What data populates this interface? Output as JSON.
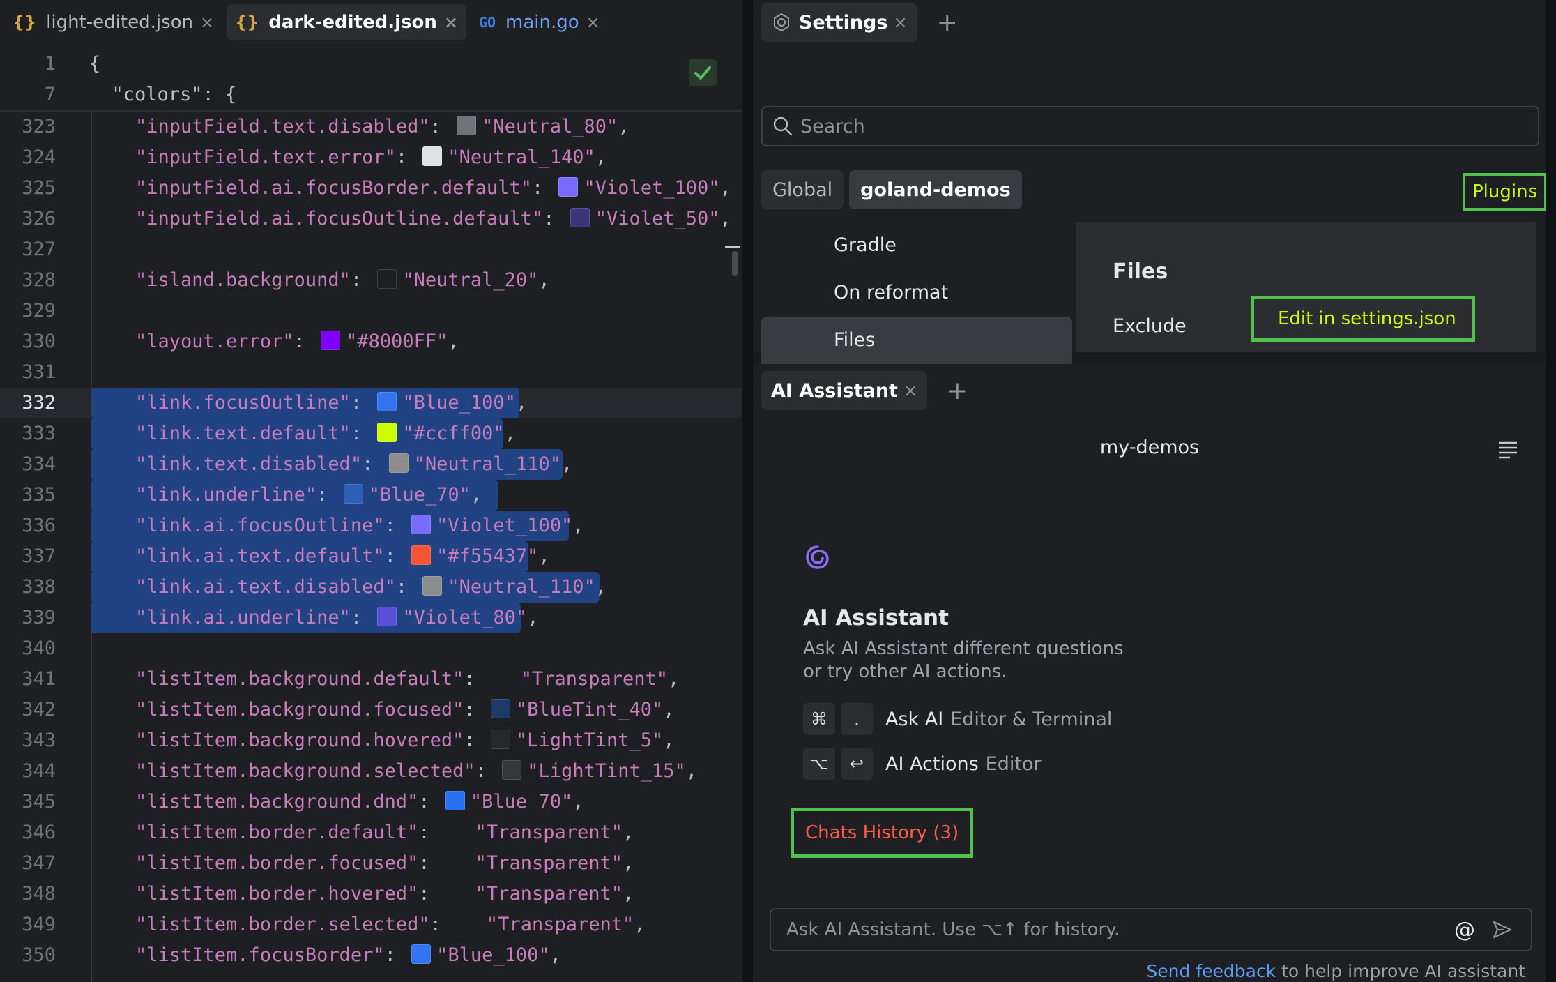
{
  "editor": {
    "tabs": [
      {
        "label": "light-edited.json",
        "icon": "json-braces-icon"
      },
      {
        "label": "dark-edited.json",
        "icon": "json-braces-icon"
      },
      {
        "label": "main.go",
        "icon": "go-file-icon",
        "icon_text": "GO"
      }
    ],
    "icon_json": "{}",
    "sticky": [
      {
        "num": "1",
        "text": "{"
      },
      {
        "num": "7",
        "text": "  \"colors\": {"
      }
    ],
    "lines": [
      {
        "num": "323",
        "key": "\"inputField.text.disabled\"",
        "sep": ": ",
        "color": "#6f737a",
        "val": "\"Neutral_80\"",
        "tail": ","
      },
      {
        "num": "324",
        "key": "\"inputField.text.error\"",
        "sep": ": ",
        "color": "#dfe1e5",
        "val": "\"Neutral_140\"",
        "tail": ","
      },
      {
        "num": "325",
        "key": "\"inputField.ai.focusBorder.default\"",
        "sep": ": ",
        "color": "#7a6bff",
        "val": "\"Violet_100\"",
        "tail": ","
      },
      {
        "num": "326",
        "key": "\"inputField.ai.focusOutline.default\"",
        "sep": ": ",
        "color": "#3d3577",
        "val": "\"Violet_50\"",
        "tail": ","
      },
      {
        "num": "327"
      },
      {
        "num": "328",
        "key": "\"island.background\"",
        "sep": ": ",
        "color": "#1e1f22",
        "val": "\"Neutral_20\"",
        "tail": ","
      },
      {
        "num": "329"
      },
      {
        "num": "330",
        "key": "\"layout.error\"",
        "sep": ": ",
        "color": "#8000ff",
        "val": "\"#8000FF\"",
        "tail": ","
      },
      {
        "num": "331"
      },
      {
        "num": "332",
        "key": "\"link.focusOutline\"",
        "sep": ": ",
        "color": "#3574f0",
        "val": "\"Blue_100\"",
        "tail": ","
      },
      {
        "num": "333",
        "key": "\"link.text.default\"",
        "sep": ": ",
        "color": "#ccff00",
        "val": "\"#ccff00\"",
        "tail": ","
      },
      {
        "num": "334",
        "key": "\"link.text.disabled\"",
        "sep": ": ",
        "color": "#8c8c8c",
        "val": "\"Neutral_110\"",
        "tail": ","
      },
      {
        "num": "335",
        "key": "\"link.underline\"",
        "sep": ": ",
        "color": "#2e5fb8",
        "val": "\"Blue_70\"",
        "tail": ","
      },
      {
        "num": "336",
        "key": "\"link.ai.focusOutline\"",
        "sep": ": ",
        "color": "#7a6bff",
        "val": "\"Violet_100\"",
        "tail": ","
      },
      {
        "num": "337",
        "key": "\"link.ai.text.default\"",
        "sep": ": ",
        "color": "#f55437",
        "val": "\"#f55437\"",
        "tail": ","
      },
      {
        "num": "338",
        "key": "\"link.ai.text.disabled\"",
        "sep": ": ",
        "color": "#8c8c8c",
        "val": "\"Neutral_110\"",
        "tail": ","
      },
      {
        "num": "339",
        "key": "\"link.ai.underline\"",
        "sep": ": ",
        "color": "#5a4fd6",
        "val": "\"Violet_80\"",
        "tail": ","
      },
      {
        "num": "340"
      },
      {
        "num": "341",
        "key": "\"listItem.background.default\"",
        "sep": ":    ",
        "val": "\"Transparent\"",
        "tail": ","
      },
      {
        "num": "342",
        "key": "\"listItem.background.focused\"",
        "sep": ": ",
        "color": "#1d3b66",
        "val": "\"BlueTint_40\"",
        "tail": ","
      },
      {
        "num": "343",
        "key": "\"listItem.background.hovered\"",
        "sep": ": ",
        "color": "#26282b",
        "val": "\"LightTint_5\"",
        "tail": ","
      },
      {
        "num": "344",
        "key": "\"listItem.background.selected\"",
        "sep": ": ",
        "color": "#34363a",
        "val": "\"LightTint_15\"",
        "tail": ","
      },
      {
        "num": "345",
        "key": "\"listItem.background.dnd\"",
        "sep": ": ",
        "color": "#2672f0",
        "val": "\"Blue 70\"",
        "tail": ","
      },
      {
        "num": "346",
        "key": "\"listItem.border.default\"",
        "sep": ":    ",
        "val": "\"Transparent\"",
        "tail": ","
      },
      {
        "num": "347",
        "key": "\"listItem.border.focused\"",
        "sep": ":    ",
        "val": "\"Transparent\"",
        "tail": ","
      },
      {
        "num": "348",
        "key": "\"listItem.border.hovered\"",
        "sep": ":    ",
        "val": "\"Transparent\"",
        "tail": ","
      },
      {
        "num": "349",
        "key": "\"listItem.border.selected\"",
        "sep": ":    ",
        "val": "\"Transparent\"",
        "tail": ","
      },
      {
        "num": "350",
        "key": "\"listItem.focusBorder\"",
        "sep": ": ",
        "color": "#3574f0",
        "val": "\"Blue_100\"",
        "tail": ","
      }
    ],
    "current_line": "332",
    "selected_lines": [
      "332",
      "333",
      "334",
      "335",
      "336",
      "337",
      "338",
      "339"
    ]
  },
  "settings": {
    "tab_label": "Settings",
    "search_placeholder": "Search",
    "scope": [
      "Global",
      "goland-demos"
    ],
    "plugins_link": "Plugins",
    "list": [
      "Gradle",
      "On reformat",
      "Files"
    ],
    "detail_title": "Files",
    "exclude_label": "Exclude",
    "edit_link": "Edit in settings.json"
  },
  "ai": {
    "tab_label": "AI Assistant",
    "project": "my-demos",
    "title": "AI Assistant",
    "desc_line1": "Ask AI Assistant different questions",
    "desc_line2": "or try other AI actions.",
    "hotkeys": [
      {
        "keys": [
          "⌘",
          "."
        ],
        "name": "Ask AI",
        "scope": "Editor & Terminal"
      },
      {
        "keys": [
          "⌥",
          "↩"
        ],
        "name": "AI Actions",
        "scope": "Editor"
      }
    ],
    "chats_history": "Chats History (3)",
    "input_placeholder": "Ask AI Assistant. Use ⌥↑ for history.",
    "mention": "@",
    "feedback_link": "Send feedback",
    "feedback_rest": " to help improve AI assistant"
  },
  "colors": {
    "accent_green": "#4fc24d",
    "link_lime": "#ccff00",
    "chats_red": "#ff5a4a",
    "selection": "#214283"
  }
}
